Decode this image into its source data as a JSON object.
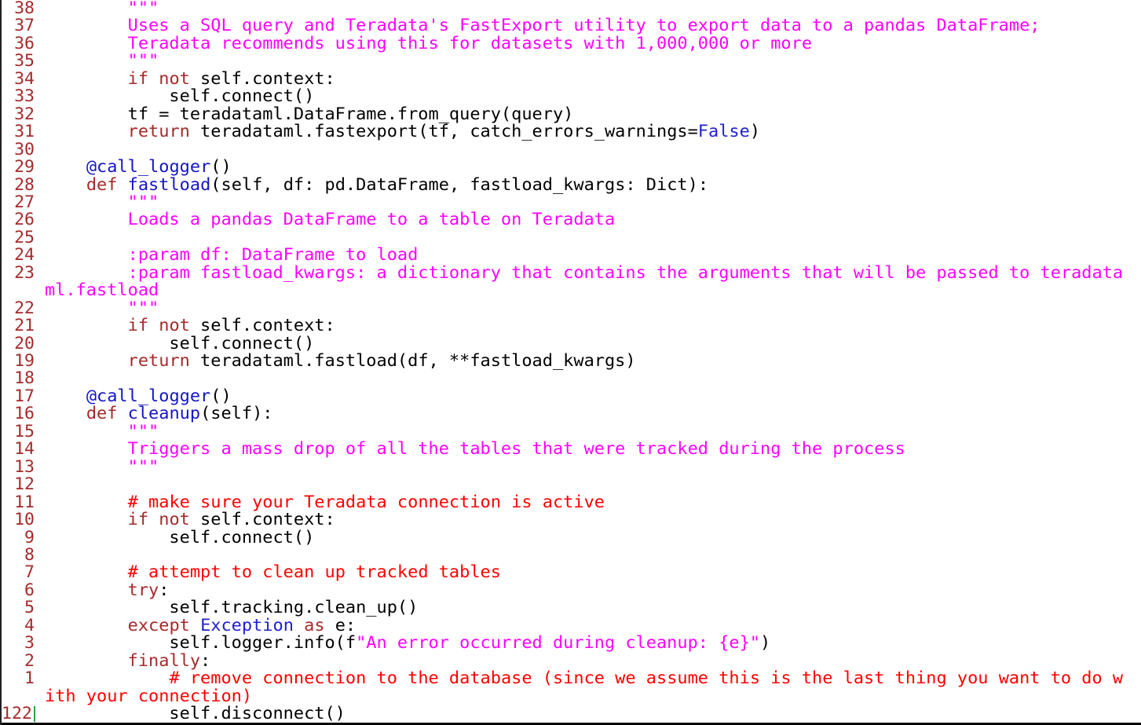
{
  "editor": {
    "lines": [
      {
        "num": "38",
        "parts": [
          {
            "t": "        \"\"\"",
            "c": "str"
          }
        ]
      },
      {
        "num": "37",
        "parts": [
          {
            "t": "        Uses a SQL query and Teradata's FastExport utility to export data to a pandas DataFrame;",
            "c": "str"
          }
        ]
      },
      {
        "num": "36",
        "parts": [
          {
            "t": "        Teradata recommends using this for datasets with 1,000,000 or more",
            "c": "str"
          }
        ]
      },
      {
        "num": "35",
        "parts": [
          {
            "t": "        \"\"\"",
            "c": "str"
          }
        ]
      },
      {
        "num": "34",
        "parts": [
          {
            "t": "        ",
            "c": ""
          },
          {
            "t": "if not",
            "c": "kw"
          },
          {
            "t": " self.context:",
            "c": ""
          }
        ]
      },
      {
        "num": "33",
        "parts": [
          {
            "t": "            self.connect()",
            "c": ""
          }
        ]
      },
      {
        "num": "32",
        "parts": [
          {
            "t": "        tf = teradataml.DataFrame.from_query(query)",
            "c": ""
          }
        ]
      },
      {
        "num": "31",
        "parts": [
          {
            "t": "        ",
            "c": ""
          },
          {
            "t": "return",
            "c": "kw"
          },
          {
            "t": " teradataml.fastexport(tf, catch_errors_warnings=",
            "c": ""
          },
          {
            "t": "False",
            "c": "bi"
          },
          {
            "t": ")",
            "c": ""
          }
        ]
      },
      {
        "num": "30",
        "parts": [
          {
            "t": "",
            "c": ""
          }
        ]
      },
      {
        "num": "29",
        "parts": [
          {
            "t": "    ",
            "c": ""
          },
          {
            "t": "@call_logger",
            "c": "fn"
          },
          {
            "t": "()",
            "c": ""
          }
        ]
      },
      {
        "num": "28",
        "parts": [
          {
            "t": "    ",
            "c": ""
          },
          {
            "t": "def",
            "c": "kw"
          },
          {
            "t": " ",
            "c": ""
          },
          {
            "t": "fastload",
            "c": "fn"
          },
          {
            "t": "(self, df: pd.DataFrame, fastload_kwargs: Dict):",
            "c": ""
          }
        ]
      },
      {
        "num": "27",
        "parts": [
          {
            "t": "        \"\"\"",
            "c": "str"
          }
        ]
      },
      {
        "num": "26",
        "parts": [
          {
            "t": "        Loads a pandas DataFrame to a table on Teradata",
            "c": "str"
          }
        ]
      },
      {
        "num": "25",
        "parts": [
          {
            "t": "",
            "c": ""
          }
        ]
      },
      {
        "num": "24",
        "parts": [
          {
            "t": "        :param df: DataFrame to load",
            "c": "str"
          }
        ]
      },
      {
        "num": "23",
        "parts": [
          {
            "t": "        :param fastload_kwargs: a dictionary that contains the arguments that will be passed to teradata",
            "c": "str"
          }
        ]
      },
      {
        "num": "",
        "parts": [
          {
            "t": "ml.fastload",
            "c": "str"
          }
        ]
      },
      {
        "num": "22",
        "parts": [
          {
            "t": "        \"\"\"",
            "c": "str"
          }
        ]
      },
      {
        "num": "21",
        "parts": [
          {
            "t": "        ",
            "c": ""
          },
          {
            "t": "if not",
            "c": "kw"
          },
          {
            "t": " self.context:",
            "c": ""
          }
        ]
      },
      {
        "num": "20",
        "parts": [
          {
            "t": "            self.connect()",
            "c": ""
          }
        ]
      },
      {
        "num": "19",
        "parts": [
          {
            "t": "        ",
            "c": ""
          },
          {
            "t": "return",
            "c": "kw"
          },
          {
            "t": " teradataml.fastload(df, **fastload_kwargs)",
            "c": ""
          }
        ]
      },
      {
        "num": "18",
        "parts": [
          {
            "t": "",
            "c": ""
          }
        ]
      },
      {
        "num": "17",
        "parts": [
          {
            "t": "    ",
            "c": ""
          },
          {
            "t": "@call_logger",
            "c": "fn"
          },
          {
            "t": "()",
            "c": ""
          }
        ]
      },
      {
        "num": "16",
        "parts": [
          {
            "t": "    ",
            "c": ""
          },
          {
            "t": "def",
            "c": "kw"
          },
          {
            "t": " ",
            "c": ""
          },
          {
            "t": "cleanup",
            "c": "fn"
          },
          {
            "t": "(self):",
            "c": ""
          }
        ]
      },
      {
        "num": "15",
        "parts": [
          {
            "t": "        \"\"\"",
            "c": "str"
          }
        ]
      },
      {
        "num": "14",
        "parts": [
          {
            "t": "        Triggers a mass drop of all the tables that were tracked during the process",
            "c": "str"
          }
        ]
      },
      {
        "num": "13",
        "parts": [
          {
            "t": "        \"\"\"",
            "c": "str"
          }
        ]
      },
      {
        "num": "12",
        "parts": [
          {
            "t": "",
            "c": ""
          }
        ]
      },
      {
        "num": "11",
        "parts": [
          {
            "t": "        ",
            "c": ""
          },
          {
            "t": "# make sure your Teradata connection is active",
            "c": "cmt"
          }
        ]
      },
      {
        "num": "10",
        "parts": [
          {
            "t": "        ",
            "c": ""
          },
          {
            "t": "if not",
            "c": "kw"
          },
          {
            "t": " self.context:",
            "c": ""
          }
        ]
      },
      {
        "num": "9",
        "parts": [
          {
            "t": "            self.connect()",
            "c": ""
          }
        ]
      },
      {
        "num": "8",
        "parts": [
          {
            "t": "",
            "c": ""
          }
        ]
      },
      {
        "num": "7",
        "parts": [
          {
            "t": "        ",
            "c": ""
          },
          {
            "t": "# attempt to clean up tracked tables",
            "c": "cmt"
          }
        ]
      },
      {
        "num": "6",
        "parts": [
          {
            "t": "        ",
            "c": ""
          },
          {
            "t": "try",
            "c": "kw"
          },
          {
            "t": ":",
            "c": ""
          }
        ]
      },
      {
        "num": "5",
        "parts": [
          {
            "t": "            self.tracking.clean_up()",
            "c": ""
          }
        ]
      },
      {
        "num": "4",
        "parts": [
          {
            "t": "        ",
            "c": ""
          },
          {
            "t": "except",
            "c": "kw"
          },
          {
            "t": " ",
            "c": ""
          },
          {
            "t": "Exception",
            "c": "bi"
          },
          {
            "t": " ",
            "c": ""
          },
          {
            "t": "as",
            "c": "kw"
          },
          {
            "t": " e:",
            "c": ""
          }
        ]
      },
      {
        "num": "3",
        "parts": [
          {
            "t": "            self.logger.info(f",
            "c": ""
          },
          {
            "t": "\"An error occurred during cleanup: {e}\"",
            "c": "str"
          },
          {
            "t": ")",
            "c": ""
          }
        ]
      },
      {
        "num": "2",
        "parts": [
          {
            "t": "        ",
            "c": ""
          },
          {
            "t": "finally",
            "c": "kw"
          },
          {
            "t": ":",
            "c": ""
          }
        ]
      },
      {
        "num": "1",
        "parts": [
          {
            "t": "            ",
            "c": ""
          },
          {
            "t": "# remove connection to the database (since we assume this is the last thing you want to do w",
            "c": "cmt"
          }
        ]
      },
      {
        "num": "",
        "parts": [
          {
            "t": "ith your connection)",
            "c": "cmt"
          }
        ]
      },
      {
        "num": "122",
        "cursor": true,
        "parts": [
          {
            "t": "            self.disconnect()",
            "c": ""
          }
        ]
      }
    ]
  }
}
